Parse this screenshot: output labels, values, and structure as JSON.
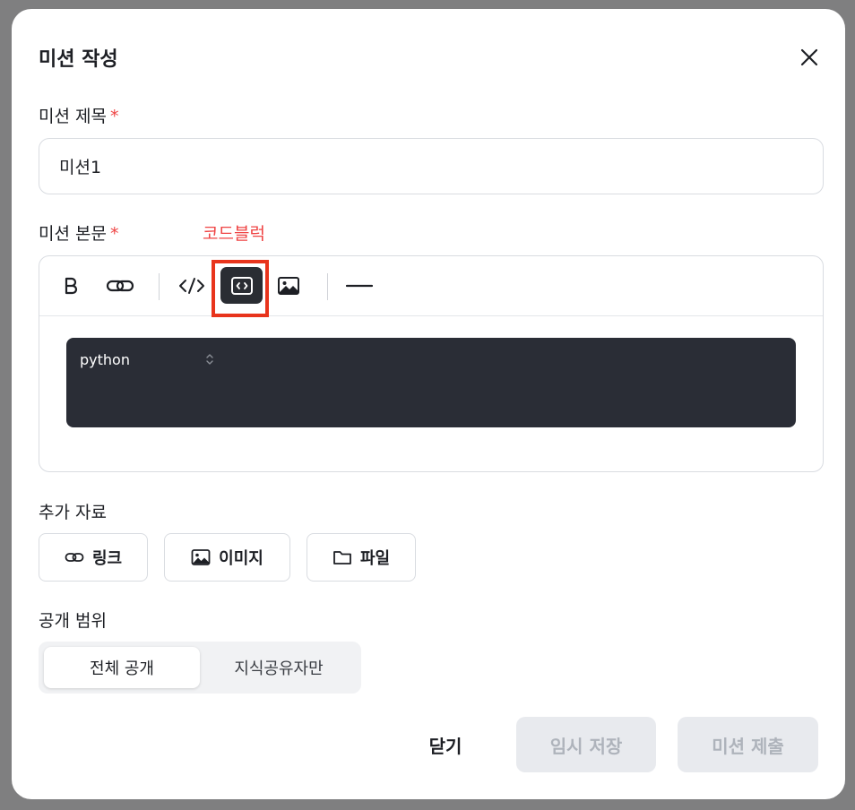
{
  "dialog": {
    "title": "미션 작성",
    "close_icon": "close-icon"
  },
  "mission_title": {
    "label": "미션 제목",
    "required_mark": "*",
    "value": "미션1"
  },
  "mission_body": {
    "label": "미션 본문",
    "required_mark": "*",
    "annotation": "코드블럭",
    "annotation_color": "#ef4444",
    "toolbar": [
      "bold-icon",
      "link-icon",
      "inline-code-icon",
      "code-block-icon",
      "image-icon",
      "horizontal-rule-icon"
    ],
    "code_block": {
      "language": "python",
      "background": "#2a2d36"
    }
  },
  "attachments": {
    "label": "추가 자료",
    "link_label": "링크",
    "image_label": "이미지",
    "file_label": "파일"
  },
  "visibility": {
    "label": "공개 범위",
    "option_all": "전체 공개",
    "option_sharers": "지식공유자만",
    "selected": "전체 공개"
  },
  "footer": {
    "close_label": "닫기",
    "draft_label": "임시 저장",
    "submit_label": "미션 제출"
  },
  "colors": {
    "required": "#ef4444",
    "highlight_border": "#e8341c",
    "disabled_bg": "#e8eaee",
    "disabled_text": "#aeb3bb"
  }
}
